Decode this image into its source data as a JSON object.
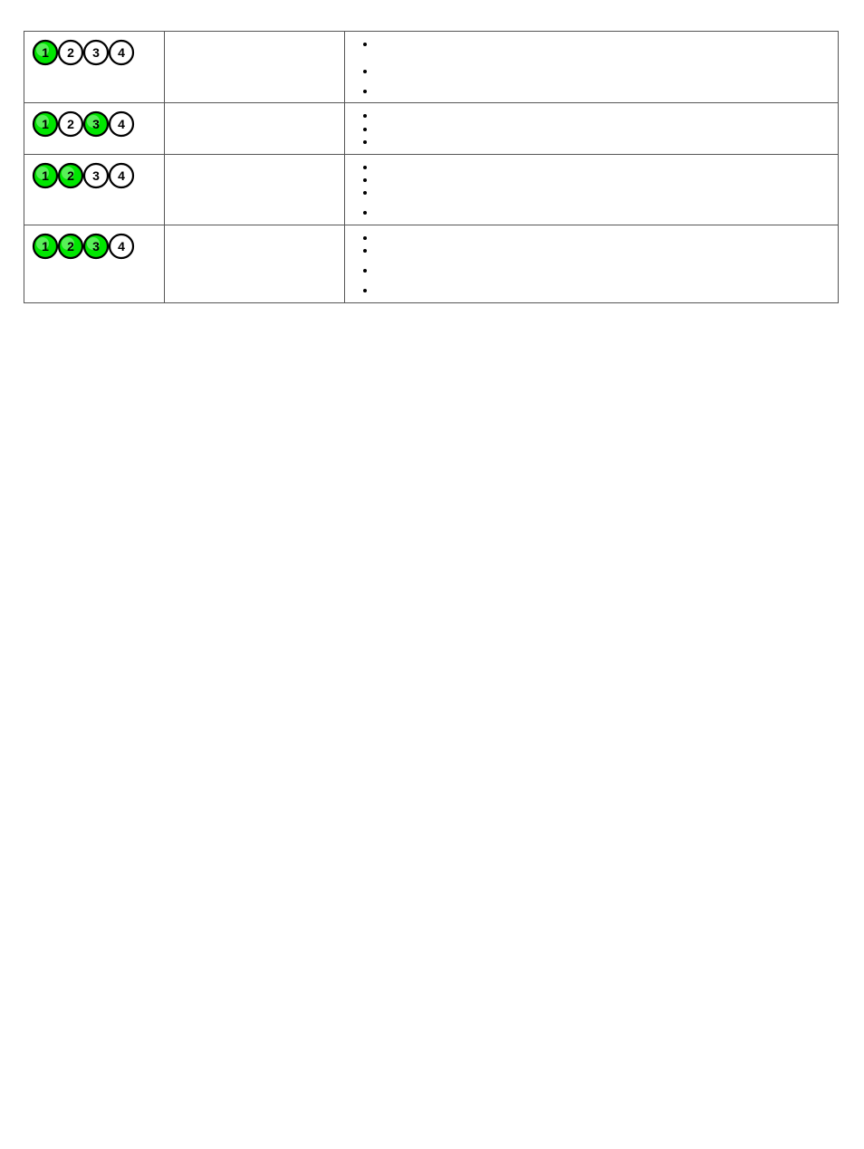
{
  "colors": {
    "led_on": "#00e600",
    "led_off": "#ffffff",
    "led_stroke": "#000000"
  },
  "rows": [
    {
      "leds": [
        true,
        false,
        false,
        false
      ],
      "middle": "",
      "bullets": [
        {
          "text": "",
          "size": "tall"
        },
        {
          "text": "",
          "size": "med"
        },
        {
          "text": "",
          "size": ""
        }
      ]
    },
    {
      "leds": [
        true,
        false,
        true,
        false
      ],
      "middle": "",
      "bullets": [
        {
          "text": "",
          "size": ""
        },
        {
          "text": "",
          "size": ""
        },
        {
          "text": "",
          "size": ""
        }
      ]
    },
    {
      "leds": [
        true,
        true,
        false,
        false
      ],
      "middle": "",
      "bullets": [
        {
          "text": "",
          "size": ""
        },
        {
          "text": "",
          "size": ""
        },
        {
          "text": "",
          "size": "med"
        },
        {
          "text": "",
          "size": ""
        }
      ]
    },
    {
      "leds": [
        true,
        true,
        true,
        false
      ],
      "middle": "",
      "bullets": [
        {
          "text": "",
          "size": ""
        },
        {
          "text": "",
          "size": "med"
        },
        {
          "text": "",
          "size": "med"
        },
        {
          "text": "",
          "size": ""
        }
      ]
    }
  ],
  "footer_link": " "
}
